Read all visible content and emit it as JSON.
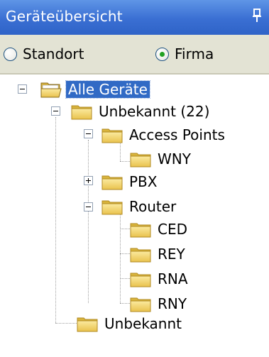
{
  "panel": {
    "title": "Geräteübersicht",
    "pin_icon": "pin-icon",
    "colors": {
      "titlebar": "#3a6fd3",
      "radiobar": "#e3e3d4",
      "selection": "#316ac5",
      "folder": "#f3d465"
    }
  },
  "radio_group": {
    "options": [
      {
        "label": "Standort",
        "selected": false
      },
      {
        "label": "Firma",
        "selected": true
      }
    ]
  },
  "tree": {
    "folder_icon": "folder-icon",
    "nodes": [
      {
        "label": "Alle Geräte",
        "expander": "minus",
        "selected": true,
        "icon": "open-folder-icon"
      },
      {
        "label": "Unbekannt (22)",
        "expander": "minus"
      },
      {
        "label": "Access Points",
        "expander": "minus"
      },
      {
        "label": "WNY"
      },
      {
        "label": "PBX",
        "expander": "plus"
      },
      {
        "label": "Router",
        "expander": "minus"
      },
      {
        "label": "CED"
      },
      {
        "label": "REY"
      },
      {
        "label": "RNA"
      },
      {
        "label": "RNY"
      },
      {
        "label": "Unbekannt"
      }
    ]
  }
}
